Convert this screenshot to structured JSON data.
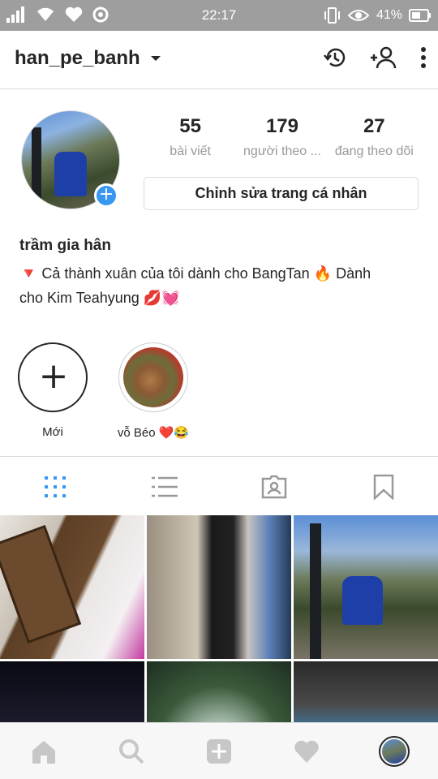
{
  "status_bar": {
    "time": "22:17",
    "battery": "41%"
  },
  "header": {
    "username": "han_pe_banh"
  },
  "profile": {
    "posts_count": "55",
    "posts_label": "bài viết",
    "followers_count": "179",
    "followers_label": "người theo ...",
    "following_count": "27",
    "following_label": "đang theo dõi",
    "edit_button": "Chỉnh sửa trang cá nhân",
    "full_name": "trầm gia hân",
    "bio_line1": "🔻 Cả thành xuân của tôi dành cho BangTan 🔥 Dành",
    "bio_line2": "cho Kim Teahyung 💋💓"
  },
  "highlights": [
    {
      "label": "Mới"
    },
    {
      "label": "vỗ Béo ❤️😂"
    }
  ],
  "icons": {
    "statusbar_left": [
      "signal-icon",
      "wifi-icon",
      "heart-icon",
      "settings-icon"
    ],
    "statusbar_right": [
      "vibrate-icon",
      "eye-icon",
      "battery-icon"
    ],
    "header": [
      "history-icon",
      "add-user-icon",
      "more-icon"
    ],
    "tabs": [
      "grid-icon",
      "list-icon",
      "tagged-icon",
      "saved-icon"
    ],
    "bottom_nav": [
      "home-icon",
      "search-icon",
      "add-post-icon",
      "activity-icon",
      "profile-avatar-icon"
    ]
  },
  "colors": {
    "accent": "#3897f0",
    "status_bar": "#9e9e9e",
    "text": "#262626",
    "muted": "#999999"
  }
}
